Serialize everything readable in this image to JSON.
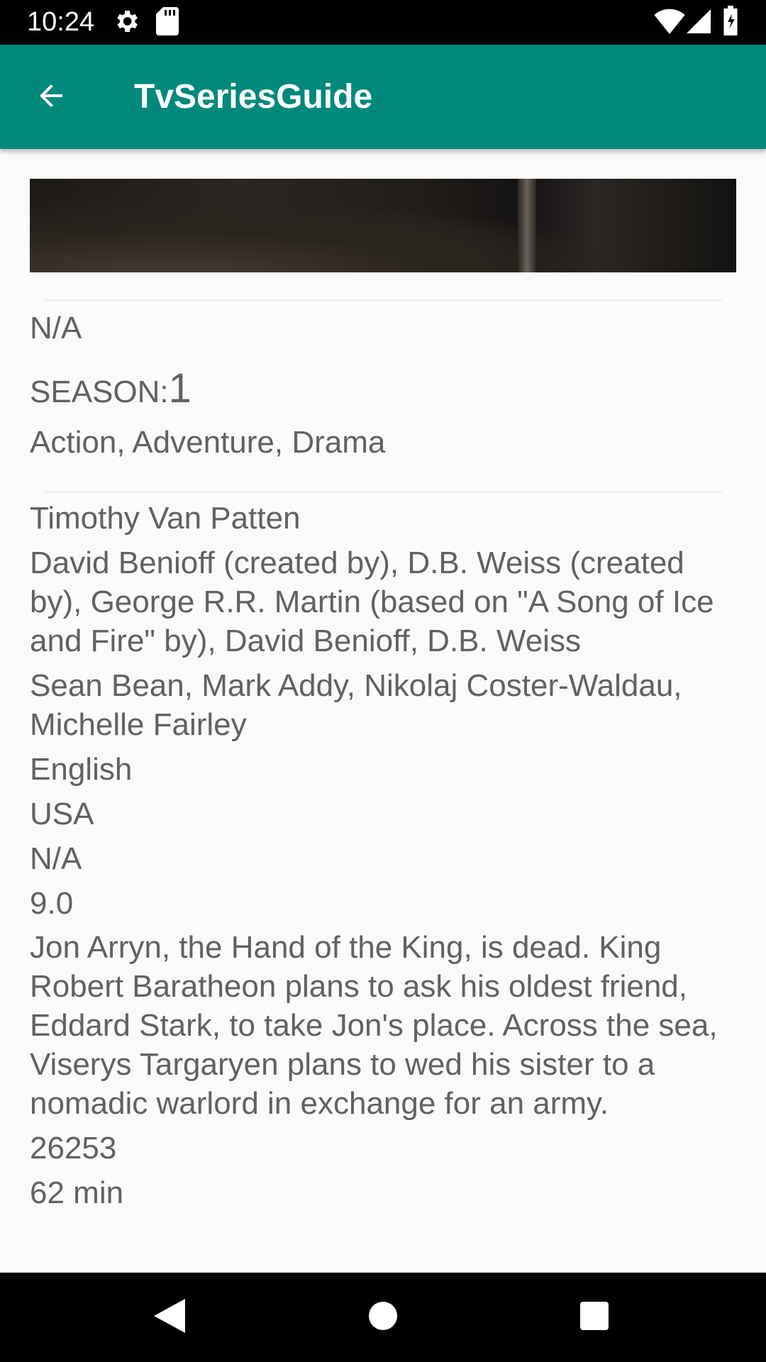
{
  "status_bar": {
    "time": "10:24",
    "icons": [
      "settings-icon",
      "sd-card-icon",
      "wifi-icon",
      "signal-icon",
      "battery-icon"
    ]
  },
  "app_bar": {
    "title": "TvSeriesGuide",
    "back_icon": "arrow-back-icon",
    "background_color": "#00897b"
  },
  "episode": {
    "released": "N/A",
    "season_label": "SEASON:",
    "season_number": "1",
    "genre": "Action, Adventure, Drama",
    "director": "Timothy Van Patten",
    "writers": "David Benioff (created by), D.B. Weiss (created by), George R.R. Martin (based on \"A Song of Ice and Fire\" by), David Benioff, D.B. Weiss",
    "actors": "Sean Bean, Mark Addy, Nikolaj Coster-Waldau, Michelle Fairley",
    "language": "English",
    "country": "USA",
    "awards": "N/A",
    "rating": "9.0",
    "plot": "Jon Arryn, the Hand of the King, is dead. King Robert Baratheon plans to ask his oldest friend, Eddard Stark, to take Jon's place. Across the sea, Viserys Targaryen plans to wed his sister to a nomadic warlord in exchange for an army.",
    "votes": "26253",
    "runtime": "62 min"
  },
  "nav_bar": {
    "icons": [
      "back-triangle-icon",
      "home-circle-icon",
      "recents-square-icon"
    ]
  }
}
